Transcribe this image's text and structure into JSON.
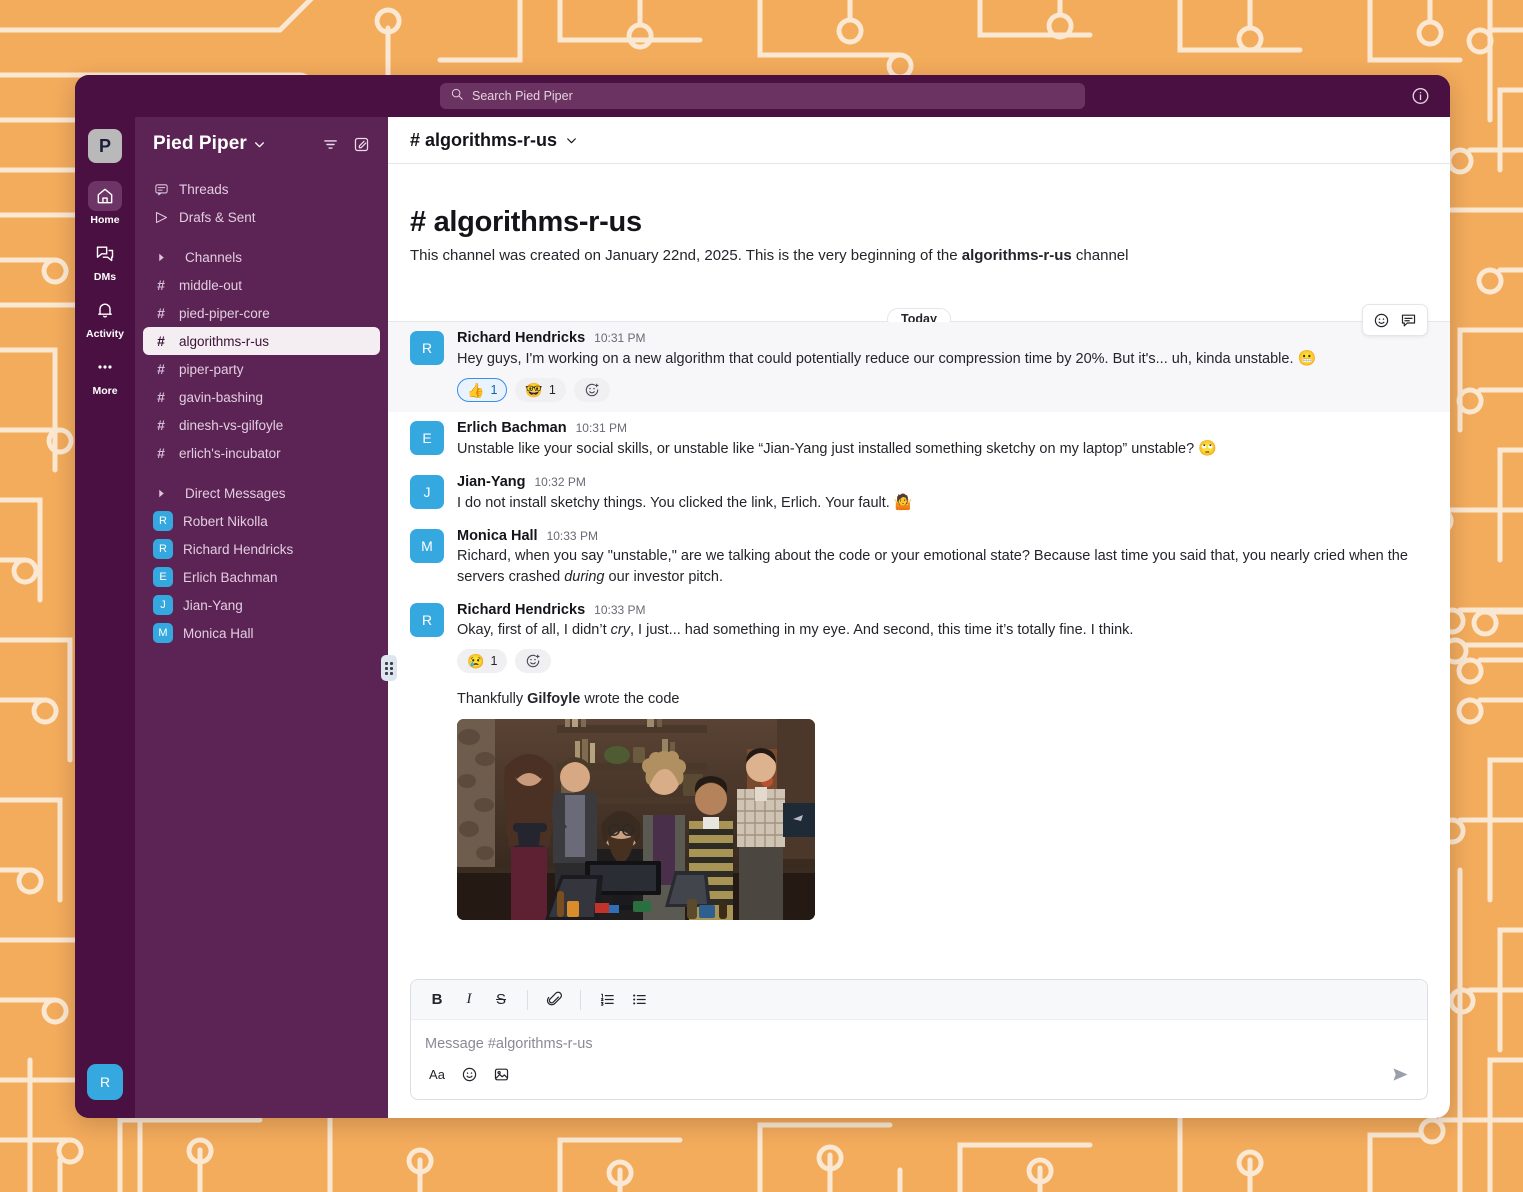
{
  "theme": {
    "bg_orange": "#f3ab5c",
    "circuit_line": "#fbe8d2",
    "window_purple": "#4a1042",
    "sidebar_purple": "#5b2455",
    "avatar_blue": "#36a8e0",
    "accent_blue": "#1264a3"
  },
  "topbar": {
    "search_placeholder": "Search Pied Piper",
    "search_icon": "search-icon",
    "info_icon": "info-circle-icon"
  },
  "rail": {
    "workspace_initial": "P",
    "items": [
      {
        "label": "Home",
        "icon": "home-icon",
        "active": true
      },
      {
        "label": "DMs",
        "icon": "chat-bubbles-icon",
        "active": false
      },
      {
        "label": "Activity",
        "icon": "bell-icon",
        "active": false
      },
      {
        "label": "More",
        "icon": "ellipsis-icon",
        "active": false
      }
    ],
    "user_avatar_initial": "R"
  },
  "sidebar": {
    "workspace_name": "Pied Piper",
    "workspace_caret": "chevron-down-icon",
    "filter_icon": "filter-icon",
    "compose_icon": "compose-icon",
    "top_items": [
      {
        "label": "Threads",
        "icon": "threads-icon"
      },
      {
        "label": "Drafs & Sent",
        "icon": "send-icon"
      }
    ],
    "channels_section": "Channels",
    "channels": [
      {
        "label": "middle-out",
        "active": false
      },
      {
        "label": "pied-piper-core",
        "active": false
      },
      {
        "label": "algorithms-r-us",
        "active": true
      },
      {
        "label": "piper-party",
        "active": false
      },
      {
        "label": "gavin-bashing",
        "active": false
      },
      {
        "label": "dinesh-vs-gilfoyle",
        "active": false
      },
      {
        "label": "erlich's-incubator",
        "active": false
      }
    ],
    "dms_section": "Direct Messages",
    "dms": [
      {
        "label": "Robert Nikolla",
        "initial": "R"
      },
      {
        "label": "Richard Hendricks",
        "initial": "R"
      },
      {
        "label": "Erlich Bachman",
        "initial": "E"
      },
      {
        "label": "Jian-Yang",
        "initial": "J"
      },
      {
        "label": "Monica Hall",
        "initial": "M"
      }
    ]
  },
  "channel": {
    "header_name": "# algorithms-r-us",
    "header_caret": "chevron-down-icon",
    "intro_title": "# algorithms-r-us",
    "intro_text_1": "This channel was created on January 22nd, 2025. This is the very beginning of the ",
    "intro_bold": "algorithms-r-us",
    "intro_text_2": " channel",
    "date_divider": "Today"
  },
  "messages": [
    {
      "author": "Richard Hendricks",
      "initial": "R",
      "time": "10:31 PM",
      "text": "Hey guys, I'm working on a new algorithm that could potentially reduce our compression time by 20%. But it's... uh, kinda unstable.",
      "trailing_emoji": "😬",
      "hovered": true,
      "reactions": [
        {
          "emoji": "👍",
          "count": "1",
          "selected": true
        },
        {
          "emoji": "🤓",
          "count": "1",
          "selected": false
        }
      ],
      "add_reaction_icon": "add-reaction-icon",
      "hover_actions": [
        "add-reaction-icon",
        "reply-in-thread-icon"
      ]
    },
    {
      "author": "Erlich Bachman",
      "initial": "E",
      "time": "10:31 PM",
      "text": "Unstable like your social skills, or unstable like “Jian-Yang just installed something sketchy on my laptop” unstable?",
      "trailing_emoji": "🙄",
      "hovered": false,
      "reactions": []
    },
    {
      "author": "Jian-Yang",
      "initial": "J",
      "time": "10:32 PM",
      "text": "I do not install sketchy things. You clicked the link, Erlich. Your fault.",
      "trailing_emoji": "🤷",
      "hovered": false,
      "reactions": []
    },
    {
      "author": "Monica Hall",
      "initial": "M",
      "time": "10:33 PM",
      "text_parts": [
        {
          "t": "Richard, when you say \"unstable,\" are we talking about the code or your emotional state? Because last time you said that, you nearly cried when the servers crashed ",
          "style": "normal"
        },
        {
          "t": "during",
          "style": "italic"
        },
        {
          "t": " our investor pitch.",
          "style": "normal"
        }
      ],
      "hovered": false,
      "reactions": []
    },
    {
      "author": "Richard Hendricks",
      "initial": "R",
      "time": "10:33 PM",
      "text_parts": [
        {
          "t": "Okay, first of all, I didn’t ",
          "style": "normal"
        },
        {
          "t": "cry",
          "style": "italic"
        },
        {
          "t": ", I just... had something in my eye. And second, this time it’s totally fine. I think.",
          "style": "normal"
        }
      ],
      "hovered": false,
      "reactions": [
        {
          "emoji": "😢",
          "count": "1",
          "selected": false
        }
      ],
      "add_reaction_icon": "add-reaction-icon"
    }
  ],
  "attachment": {
    "caption_1": "Thankfully ",
    "caption_bold": "Gilfoyle",
    "caption_2": " wrote the code",
    "image_alt": "pied-piper-team-around-monitor-photo"
  },
  "composer": {
    "placeholder": "Message #algorithms-r-us",
    "format_buttons": [
      {
        "name": "bold-button",
        "label": "B"
      },
      {
        "name": "italic-button",
        "label": "I"
      },
      {
        "name": "strikethrough-button",
        "label": "S"
      }
    ],
    "attach_icon": "paperclip-icon",
    "ordered_list_icon": "ordered-list-icon",
    "bulleted_list_icon": "bulleted-list-icon",
    "formatting_toggle_label": "Aa",
    "emoji_icon": "emoji-icon",
    "image_icon": "image-icon",
    "send_icon": "send-icon"
  }
}
